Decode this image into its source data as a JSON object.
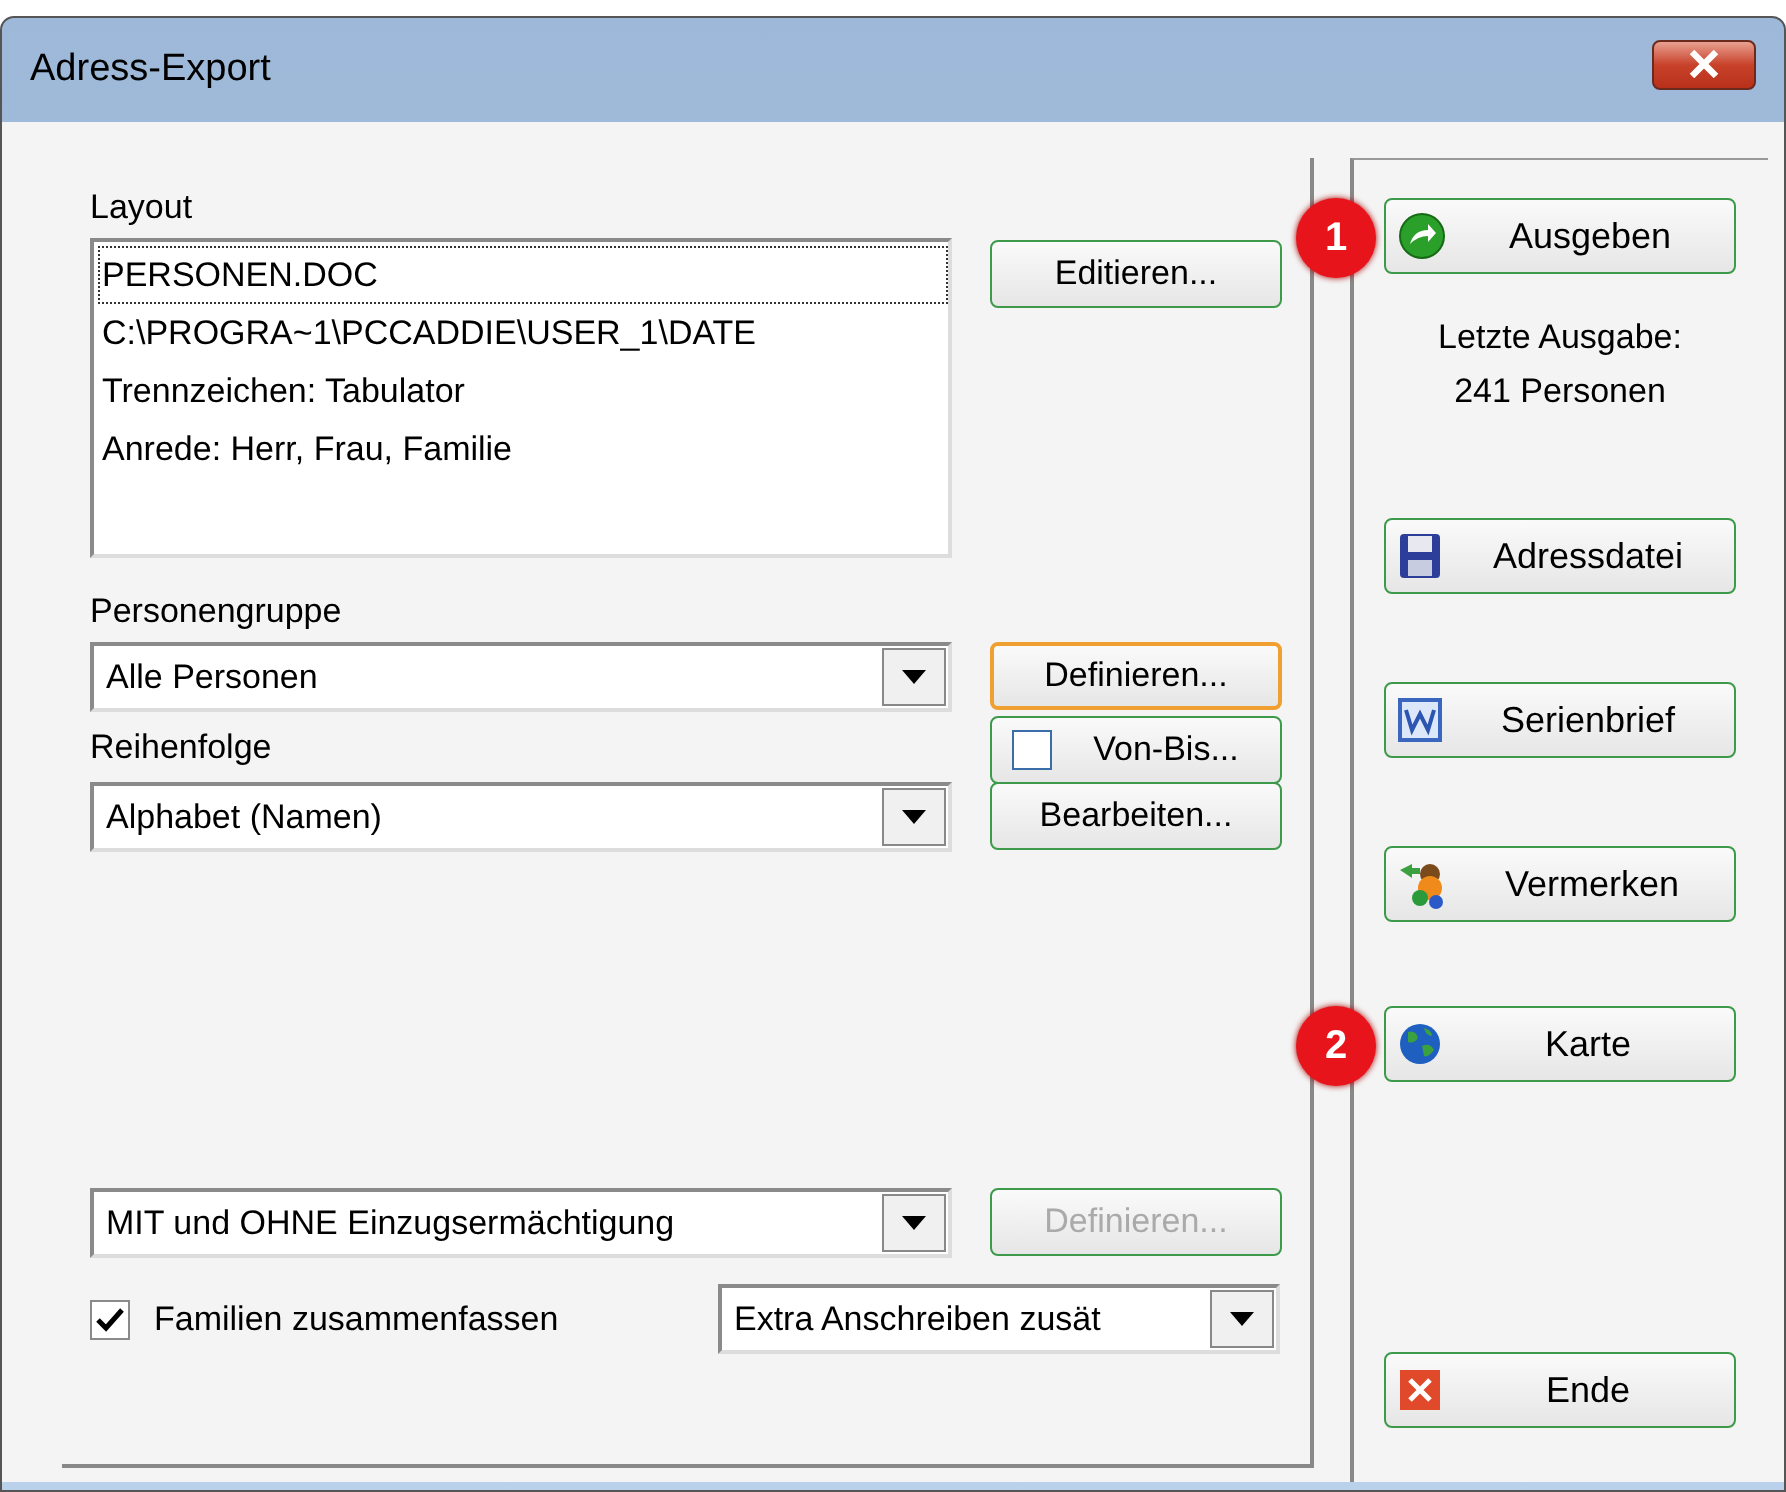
{
  "window": {
    "title": "Adress-Export"
  },
  "layout": {
    "label": "Layout",
    "items": [
      {
        "text": "PERSONEN.DOC",
        "selected": true
      },
      {
        "text": "C:\\PROGRA~1\\PCCADDIE\\USER_1\\DATE",
        "selected": false
      },
      {
        "text": "Trennzeichen: Tabulator",
        "selected": false
      },
      {
        "text": "Anrede: Herr, Frau, Familie",
        "selected": false
      }
    ],
    "button": {
      "label": "Editieren...",
      "focused": false,
      "disabled": false
    }
  },
  "person_group": {
    "label": "Personengruppe",
    "value": "Alle Personen",
    "button": {
      "label": "Definieren...",
      "focused": true,
      "disabled": false
    }
  },
  "von_bis": {
    "label": "Von-Bis...",
    "checked": false
  },
  "order": {
    "label": "Reihenfolge",
    "value": "Alphabet (Namen)",
    "button": {
      "label": "Bearbeiten...",
      "focused": false,
      "disabled": false
    }
  },
  "direct_debit": {
    "value": "MIT und OHNE Einzugsermächtigung",
    "button": {
      "label": "Definieren...",
      "focused": false,
      "disabled": true
    }
  },
  "families": {
    "label": "Familien zusammenfassen",
    "checked": true
  },
  "extra": {
    "value": "Extra Anschreiben zusät"
  },
  "primary_action": {
    "kind": "go",
    "label": "Ausgeben",
    "callout": "1"
  },
  "last_output": [
    "Letzte Ausgabe:",
    "241 Personen"
  ],
  "actions": [
    {
      "kind": "save",
      "label": "Adressdatei"
    },
    {
      "kind": "word",
      "label": "Serienbrief"
    },
    {
      "kind": "notes",
      "label": "Vermerken"
    },
    {
      "kind": "globe",
      "label": "Karte",
      "callout": "2"
    }
  ],
  "end_action": {
    "kind": "close",
    "label": "Ende"
  }
}
